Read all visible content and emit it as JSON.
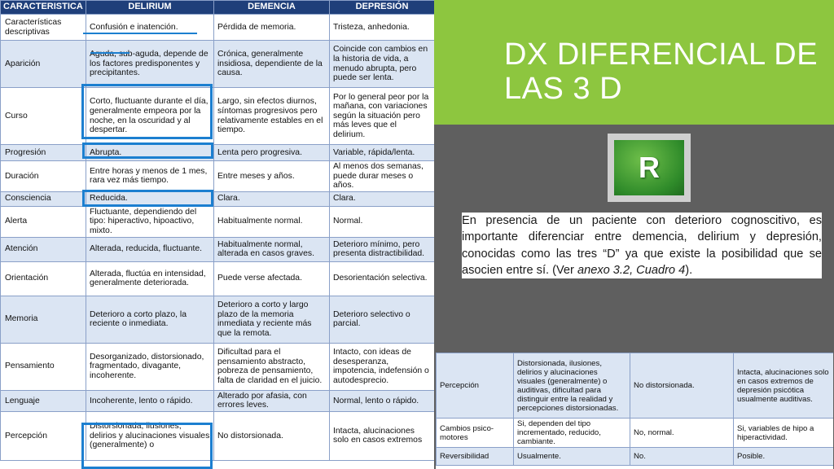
{
  "slide": {
    "title": "DX DIFERENCIAL DE LAS 3 D",
    "logo_letter": "R",
    "paragraph_part1": "En presencia de un paciente con deterioro cognoscitivo, es importante diferenciar entre demencia, delirium y depresión, conocidas como las tres “D” ya que existe la posibilidad que se asocien entre sí. (Ver ",
    "paragraph_italic": "anexo 3.2, Cuadro 4",
    "paragraph_part2": ")."
  },
  "left_table": {
    "headers": [
      "CARACTERISTICA",
      "DELIRIUM",
      "DEMENCIA",
      "DEPRESIÓN"
    ],
    "rows": [
      {
        "c0": "Características descriptivas",
        "c1": "Confusión e inatención.",
        "c2": "Pérdida de memoria.",
        "c3": "Tristeza, anhedonia."
      },
      {
        "c0": "Aparición",
        "c1": "Aguda, sub-aguda, depende de los factores predisponentes y precipitantes.",
        "c2": "Crónica, generalmente insidiosa, dependiente de la causa.",
        "c3": "Coincide con cambios en la historia de vida, a menudo abrupta, pero puede ser lenta."
      },
      {
        "c0": "Curso",
        "c1": "Corto, fluctuante durante el día, generalmente empeora por la noche, en la oscuridad y al despertar.",
        "c2": "Largo, sin efectos diurnos, síntomas progresivos pero relativamente estables en el tiempo.",
        "c3": "Por lo general peor por la mañana, con variaciones según la situación pero más leves que el delirium."
      },
      {
        "c0": "Progresión",
        "c1": "Abrupta.",
        "c2": "Lenta pero progresiva.",
        "c3": "Variable, rápida/lenta."
      },
      {
        "c0": "Duración",
        "c1": "Entre horas y menos de 1 mes, rara vez más tiempo.",
        "c2": "Entre meses y años.",
        "c3": "Al menos dos semanas, puede durar meses o años."
      },
      {
        "c0": "Consciencia",
        "c1": "Reducida.",
        "c2": "Clara.",
        "c3": "Clara."
      },
      {
        "c0": "Alerta",
        "c1": "Fluctuante, dependiendo del tipo: hiperactivo, hipoactivo, mixto.",
        "c2": "Habitualmente normal.",
        "c3": "Normal."
      },
      {
        "c0": "Atención",
        "c1": "Alterada, reducida, fluctuante.",
        "c2": "Habitualmente normal, alterada en casos graves.",
        "c3": "Deterioro mínimo, pero presenta distractibilidad."
      },
      {
        "c0": "Orientación",
        "c1": "Alterada, fluctúa en intensidad, generalmente deteriorada.",
        "c2": "Puede verse afectada.",
        "c3": "Desorientación selectiva."
      },
      {
        "c0": "Memoria",
        "c1": "Deterioro a corto plazo, la reciente o inmediata.",
        "c2": "Deterioro a corto y largo plazo de la memoria inmediata y reciente más que la remota.",
        "c3": "Deterioro selectivo o parcial."
      },
      {
        "c0": "Pensamiento",
        "c1": "Desorganizado, distorsionado, fragmentado, divagante, incoherente.",
        "c2": "Dificultad para el pensamiento abstracto, pobreza de pensamiento, falta de claridad en el juicio.",
        "c3": "Intacto, con ideas de desesperanza, impotencia, indefensión o autodesprecio."
      },
      {
        "c0": "Lenguaje",
        "c1": "Incoherente, lento o rápido.",
        "c2": "Alterado por afasia, con errores leves.",
        "c3": "Normal, lento o rápido."
      },
      {
        "c0": "Percepción",
        "c1": "Distorsionada, ilusiones, delirios y alucinaciones visuales (generalmente) o",
        "c2": "No distorsionada.",
        "c3": "Intacta, alucinaciones solo en casos extremos"
      }
    ]
  },
  "bottom_table": {
    "rows": [
      {
        "c0": "Percepción",
        "c1": "Distorsionada, ilusiones, delirios y alucinaciones visuales (generalmente) o auditivas, dificultad para distinguir entre la realidad y percepciones distorsionadas.",
        "c2": "No distorsionada.",
        "c3": "Intacta, alucinaciones solo en casos extremos de depresión psicótica usualmente auditivas."
      },
      {
        "c0": "Cambios psico-motores",
        "c1": "Si, dependen del tipo incrementado, reducido, cambiante.",
        "c2": "No, normal.",
        "c3": "Si, variables de hipo a hiperactividad."
      },
      {
        "c0": "Reversibilidad",
        "c1": "Usualmente.",
        "c2": "No.",
        "c3": "Posible."
      }
    ]
  },
  "colors": {
    "background": "#5f5f5f",
    "title_band": "#8dc63f",
    "header": "#1f3f7a",
    "highlight": "#1c7fd0",
    "row_tint": "#dbe5f3"
  }
}
